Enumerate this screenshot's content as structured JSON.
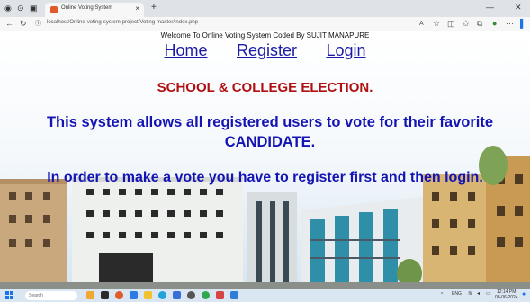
{
  "browser": {
    "tab_title": "Online Voting System",
    "tab_close": "×",
    "new_tab": "+",
    "url": "localhost/Online-voting-system-project/Voting-master/index.php",
    "min": "—",
    "close": "✕"
  },
  "page": {
    "welcome": "Welcome To Online Voting System Coded By SUJIT MANAPURE",
    "nav": {
      "home": "Home",
      "register": "Register",
      "login": "Login"
    },
    "election_title": "SCHOOL & COLLEGE ELECTION.",
    "description": "This system allows all registered users to vote for their favorite CANDIDATE.",
    "instruction": "In order to make a vote you have to register first and then login."
  },
  "taskbar": {
    "search_placeholder": "Search",
    "language": "ENG",
    "time": "12:14 PM",
    "date": "08-06-2024"
  },
  "colors": {
    "link": "#1a1aa6",
    "election": "#b01010",
    "body_text": "#1414b4"
  }
}
